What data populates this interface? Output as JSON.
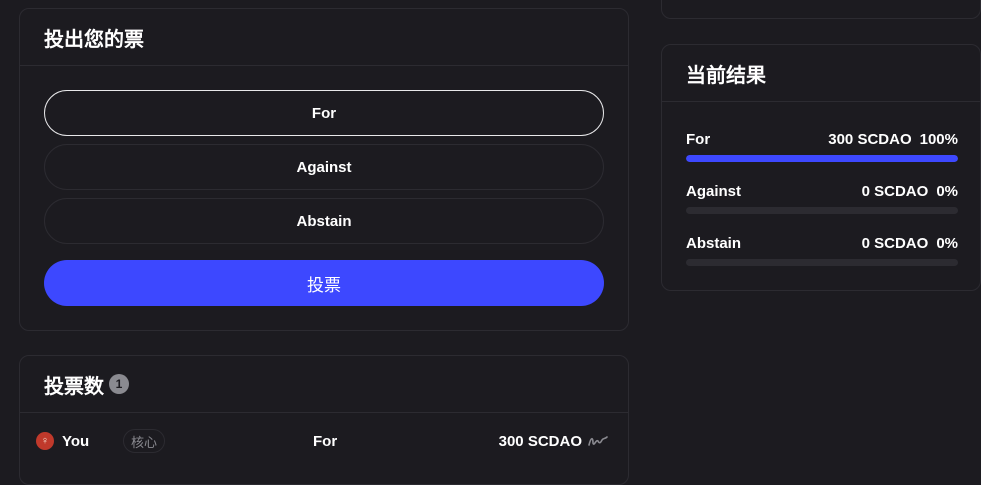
{
  "cast_vote": {
    "title": "投出您的票",
    "options": [
      "For",
      "Against",
      "Abstain"
    ],
    "selected": "For",
    "submit_label": "投票"
  },
  "votes": {
    "title": "投票数",
    "count": "1",
    "rows": [
      {
        "voter": "You",
        "role": "核心",
        "choice": "For",
        "amount": "300 SCDAO"
      }
    ]
  },
  "results": {
    "title": "当前结果",
    "items": [
      {
        "label": "For",
        "amount": "300 SCDAO",
        "percent": "100%",
        "fraction": 1.0
      },
      {
        "label": "Against",
        "amount": "0 SCDAO",
        "percent": "0%",
        "fraction": 0.0
      },
      {
        "label": "Abstain",
        "amount": "0 SCDAO",
        "percent": "0%",
        "fraction": 0.0
      }
    ]
  },
  "colors": {
    "accent": "#3d48ff",
    "background": "#1c1b20",
    "border": "#2c2b31"
  }
}
